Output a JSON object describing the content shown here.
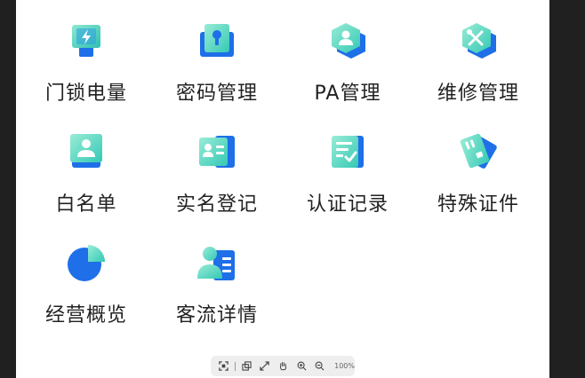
{
  "tiles": [
    {
      "label": "门锁电量",
      "icon": "battery-icon"
    },
    {
      "label": "密码管理",
      "icon": "keyhole-icon"
    },
    {
      "label": "PA管理",
      "icon": "user-hexagon-icon"
    },
    {
      "label": "维修管理",
      "icon": "tools-icon"
    },
    {
      "label": "白名单",
      "icon": "user-card-icon"
    },
    {
      "label": "实名登记",
      "icon": "id-card-icon"
    },
    {
      "label": "认证记录",
      "icon": "document-check-icon"
    },
    {
      "label": "特殊证件",
      "icon": "tilted-card-icon"
    },
    {
      "label": "经营概览",
      "icon": "pie-chart-icon"
    },
    {
      "label": "客流详情",
      "icon": "person-list-icon"
    }
  ],
  "toolbar": {
    "zoom": "100%",
    "buttons": [
      "fit-screen-icon",
      "rotate-icon",
      "fullscreen-icon",
      "hand-icon",
      "zoom-in-icon",
      "zoom-out-icon"
    ]
  },
  "colors": {
    "blue": "#1e6fe8",
    "teal": "#34c9b5",
    "mint": "#8ee8cf",
    "label": "#222222"
  }
}
